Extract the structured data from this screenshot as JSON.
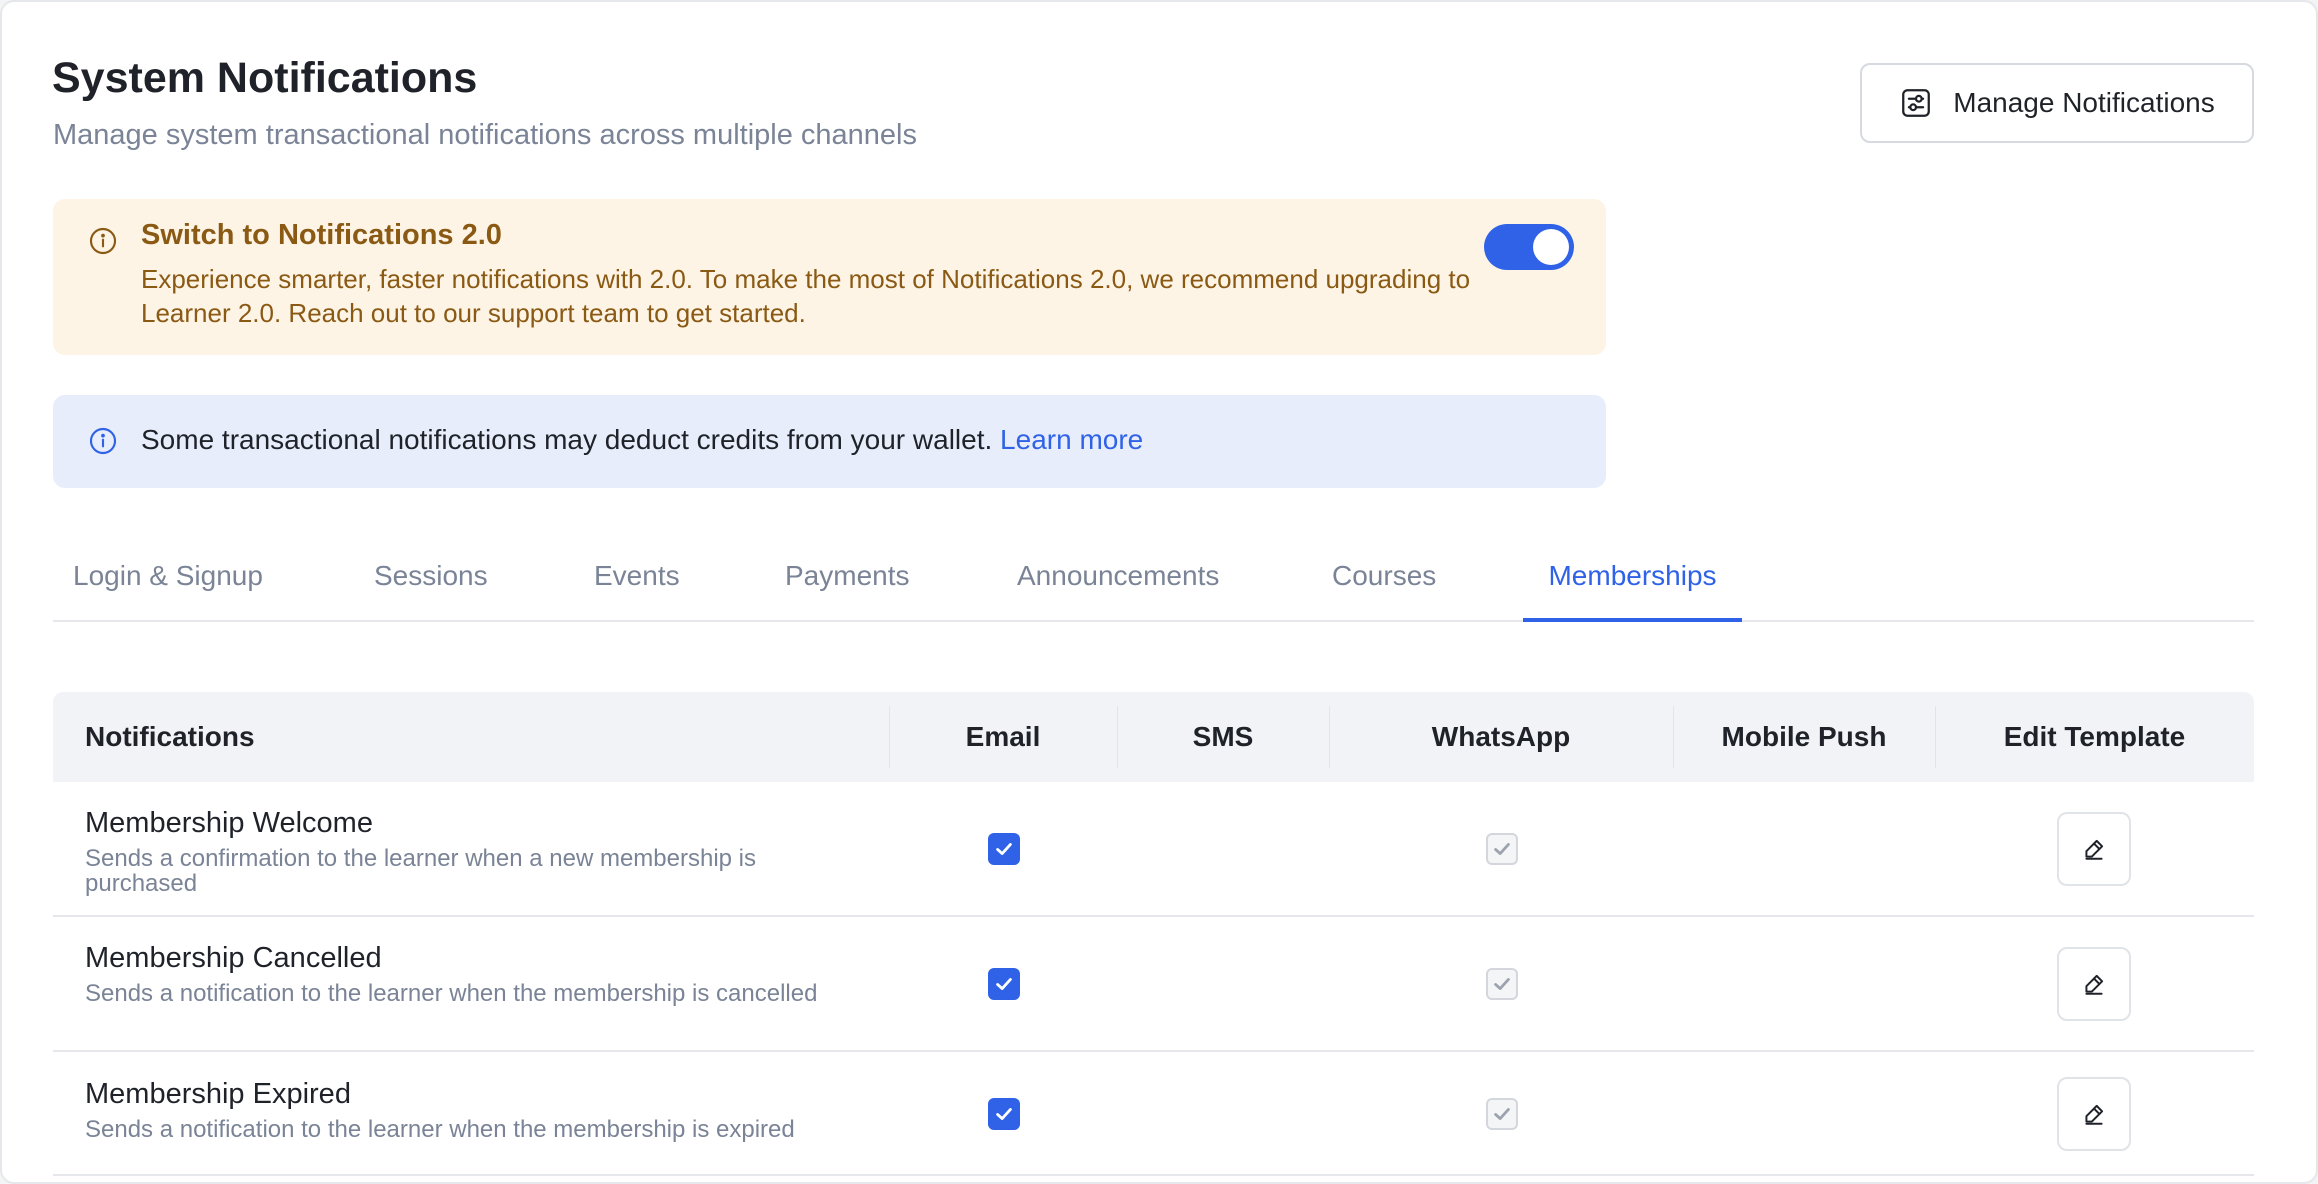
{
  "header": {
    "title": "System Notifications",
    "subtitle": "Manage system transactional notifications across multiple channels",
    "manage_button": "Manage Notifications"
  },
  "warning_banner": {
    "title": "Switch to Notifications 2.0",
    "body": "Experience smarter, faster notifications with 2.0. To make the most of Notifications 2.0, we recommend upgrading to Learner 2.0. Reach out to our support team to get started.",
    "toggle_on": true
  },
  "info_banner": {
    "text": "Some transactional notifications may deduct credits from your wallet.",
    "link": "Learn more"
  },
  "tabs": [
    {
      "label": "Login & Signup",
      "active": false
    },
    {
      "label": "Sessions",
      "active": false
    },
    {
      "label": "Events",
      "active": false
    },
    {
      "label": "Payments",
      "active": false
    },
    {
      "label": "Announcements",
      "active": false
    },
    {
      "label": "Courses",
      "active": false
    },
    {
      "label": "Memberships",
      "active": true
    }
  ],
  "table": {
    "columns": [
      "Notifications",
      "Email",
      "SMS",
      "WhatsApp",
      "Mobile Push",
      "Edit Template"
    ],
    "rows": [
      {
        "name": "Membership Welcome",
        "description": "Sends a confirmation to the learner when a new membership is purchased",
        "email": true,
        "whatsapp": true
      },
      {
        "name": "Membership Cancelled",
        "description": "Sends a notification to the learner when the membership is cancelled",
        "email": true,
        "whatsapp": true
      },
      {
        "name": "Membership Expired",
        "description": "Sends a notification to the learner when the membership is expired",
        "email": true,
        "whatsapp": true
      }
    ]
  },
  "colors": {
    "accent": "#2f62e6",
    "warning_bg": "#fdf4e6",
    "warning_text": "#8a5a14",
    "info_bg": "#e7edfb"
  },
  "icons": {
    "manage_button": "sliders-icon",
    "warning_banner": "info-circle-icon",
    "info_banner": "info-circle-icon",
    "edit": "pencil-icon",
    "check": "checkmark-icon"
  }
}
